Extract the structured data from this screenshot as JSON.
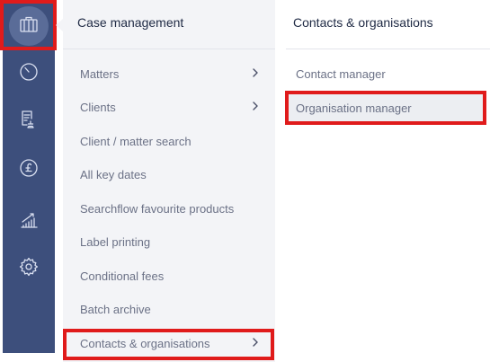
{
  "rail": {
    "items": [
      {
        "icon": "briefcase-icon",
        "active": true
      },
      {
        "icon": "clock-icon",
        "active": false
      },
      {
        "icon": "document-stamp-icon",
        "active": false
      },
      {
        "icon": "pound-coin-icon",
        "active": false
      },
      {
        "icon": "growth-chart-icon",
        "active": false
      },
      {
        "icon": "gear-icon",
        "active": false
      }
    ]
  },
  "case_management": {
    "title": "Case management",
    "items": [
      {
        "label": "Matters",
        "has_submenu": true
      },
      {
        "label": "Clients",
        "has_submenu": true
      },
      {
        "label": "Client / matter search",
        "has_submenu": false
      },
      {
        "label": "All key dates",
        "has_submenu": false
      },
      {
        "label": "Searchflow favourite products",
        "has_submenu": false
      },
      {
        "label": "Label printing",
        "has_submenu": false
      },
      {
        "label": "Conditional fees",
        "has_submenu": false
      },
      {
        "label": "Batch archive",
        "has_submenu": false
      },
      {
        "label": "Contacts & organisations",
        "has_submenu": true
      }
    ]
  },
  "contacts_organisations": {
    "title": "Contacts & organisations",
    "items": [
      {
        "label": "Contact manager",
        "active": false
      },
      {
        "label": "Organisation manager",
        "active": true
      }
    ]
  },
  "colors": {
    "rail_bg": "#3d4f7c",
    "rail_active": "#5a6c98",
    "panel_bg": "#f3f4f7",
    "highlight": "#e01b1b",
    "text_muted": "#6b7186",
    "text_heading": "#1f2a44"
  }
}
